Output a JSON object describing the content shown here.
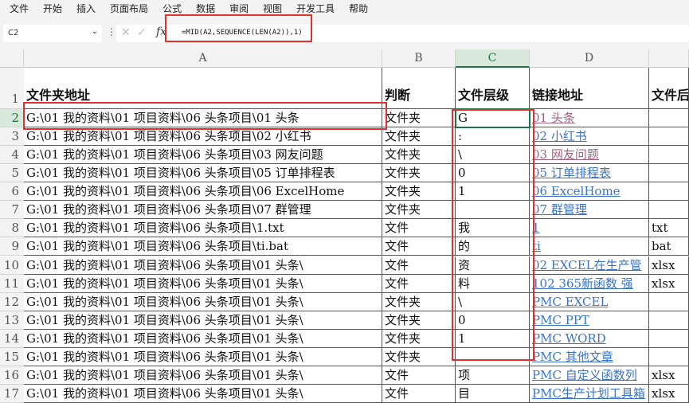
{
  "menu": [
    "文件",
    "开始",
    "插入",
    "页面布局",
    "公式",
    "数据",
    "审阅",
    "视图",
    "开发工具",
    "帮助"
  ],
  "formula_bar": {
    "name_box": "C2",
    "formula": "=MID(A2,SEQUENCE(LEN(A2)),1)",
    "fx_label": "fx"
  },
  "columns": [
    "A",
    "B",
    "C",
    "D"
  ],
  "header_row": {
    "row": "1",
    "a": "文件夹地址",
    "b": "判断",
    "c": "文件层级",
    "d": "链接地址",
    "e": "文件后"
  },
  "rows": [
    {
      "n": "2",
      "a": "G:\\01 我的资料\\01 项目资料\\06 头条项目\\01 头条",
      "b": "文件夹",
      "c": "G",
      "d": "01 头条",
      "dv": true,
      "e": ""
    },
    {
      "n": "3",
      "a": "G:\\01 我的资料\\01 项目资料\\06 头条项目\\02 小红书",
      "b": "文件夹",
      "c": ":",
      "d": "02 小红书",
      "dv": false,
      "e": ""
    },
    {
      "n": "4",
      "a": "G:\\01 我的资料\\01 项目资料\\06 头条项目\\03 网友问题",
      "b": "文件夹",
      "c": "\\",
      "d": "03 网友问题",
      "dv": true,
      "e": ""
    },
    {
      "n": "5",
      "a": "G:\\01 我的资料\\01 项目资料\\06 头条项目\\05 订单排程表",
      "b": "文件夹",
      "c": "0",
      "d": "05 订单排程表",
      "dv": false,
      "e": ""
    },
    {
      "n": "6",
      "a": "G:\\01 我的资料\\01 项目资料\\06 头条项目\\06 ExcelHome",
      "b": "文件夹",
      "c": "1",
      "d": "06 ExcelHome",
      "dv": false,
      "e": ""
    },
    {
      "n": "7",
      "a": "G:\\01 我的资料\\01 项目资料\\06 头条项目\\07 群管理",
      "b": "文件夹",
      "c": "",
      "d": "07 群管理",
      "dv": false,
      "e": ""
    },
    {
      "n": "8",
      "a": "G:\\01 我的资料\\01 项目资料\\06 头条项目\\1.txt",
      "b": "文件",
      "c": "我",
      "d": "1",
      "dv": false,
      "e": "txt"
    },
    {
      "n": "9",
      "a": "G:\\01 我的资料\\01 项目资料\\06 头条项目\\ti.bat",
      "b": "文件",
      "c": "的",
      "d": "ti",
      "dv": false,
      "e": "bat"
    },
    {
      "n": "10",
      "a": "G:\\01 我的资料\\01 项目资料\\06 头条项目\\01 头条\\",
      "b": "文件",
      "c": "资",
      "d": "02 EXCEL在生产管",
      "dv": false,
      "e": "xlsx"
    },
    {
      "n": "11",
      "a": "G:\\01 我的资料\\01 项目资料\\06 头条项目\\01 头条\\",
      "b": "文件",
      "c": "料",
      "d": "102 365新函数 强",
      "dv": false,
      "e": "xlsx"
    },
    {
      "n": "12",
      "a": "G:\\01 我的资料\\01 项目资料\\06 头条项目\\01 头条\\",
      "b": "文件夹",
      "c": "\\",
      "d": "PMC EXCEL",
      "dv": false,
      "e": ""
    },
    {
      "n": "13",
      "a": "G:\\01 我的资料\\01 项目资料\\06 头条项目\\01 头条\\",
      "b": "文件夹",
      "c": "0",
      "d": "PMC PPT",
      "dv": false,
      "e": ""
    },
    {
      "n": "14",
      "a": "G:\\01 我的资料\\01 项目资料\\06 头条项目\\01 头条\\",
      "b": "文件夹",
      "c": "1",
      "d": "PMC WORD",
      "dv": false,
      "e": ""
    },
    {
      "n": "15",
      "a": "G:\\01 我的资料\\01 项目资料\\06 头条项目\\01 头条\\",
      "b": "文件夹",
      "c": "",
      "d": "PMC 其他文章",
      "dv": false,
      "e": ""
    },
    {
      "n": "16",
      "a": "G:\\01 我的资料\\01 项目资料\\06 头条项目\\01 头条\\",
      "b": "文件",
      "c": "项",
      "d": "PMC 自定义函数列",
      "dv": false,
      "e": "xlsx"
    },
    {
      "n": "17",
      "a": "G:\\01 我的资料\\01 项目资料\\06 头条项目\\01 头条\\",
      "b": "文件",
      "c": "目",
      "d": "PMC生产计划工具箱",
      "dv": false,
      "e": "xlsx"
    }
  ]
}
